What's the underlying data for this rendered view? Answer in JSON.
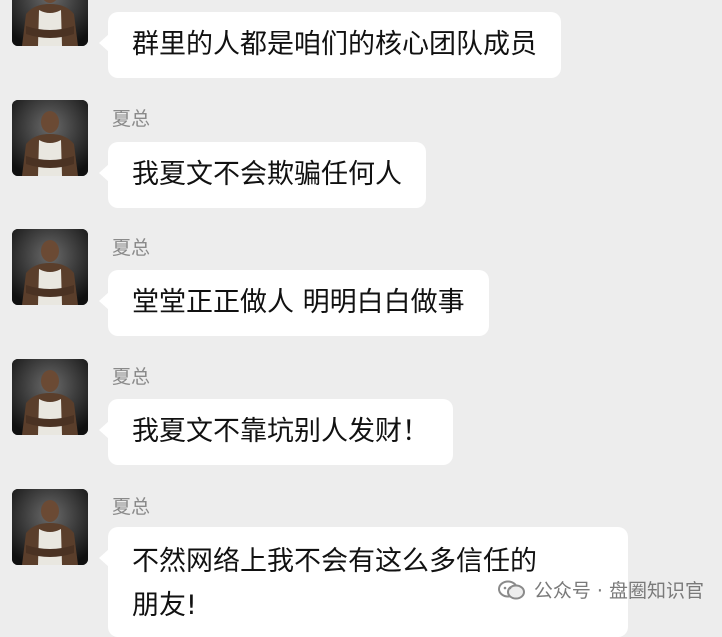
{
  "messages": [
    {
      "sender": "",
      "text": "群里的人都是咱们的核心团队成员"
    },
    {
      "sender": "夏总",
      "text": "我夏文不会欺骗任何人"
    },
    {
      "sender": "夏总",
      "text": "堂堂正正做人 明明白白做事"
    },
    {
      "sender": "夏总",
      "text": "我夏文不靠坑别人发财！"
    },
    {
      "sender": "夏总",
      "text_line1": "不然网络上我不会有这么多信任的",
      "text_line2": "朋友!"
    }
  ],
  "watermark": {
    "text": "公众号 · 盘圈知识官",
    "icon": "wechat-official-account-icon"
  },
  "colors": {
    "background": "#ededed",
    "bubble": "#ffffff",
    "sender": "#8a8a8a",
    "text": "#111111"
  }
}
